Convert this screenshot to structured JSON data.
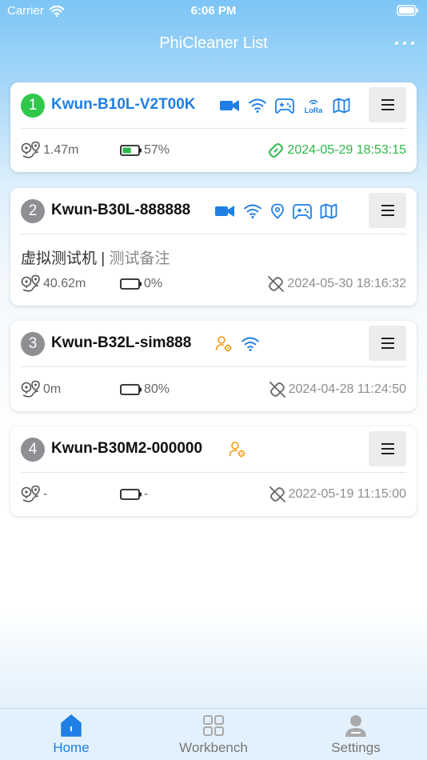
{
  "status_bar": {
    "carrier": "Carrier",
    "time": "6:06 PM"
  },
  "nav": {
    "title": "PhiCleaner List"
  },
  "colors": {
    "accent": "#1f7fe4",
    "online_green": "#2fb84a",
    "offline_gray": "#8e8e93",
    "warning_orange": "#f39c12"
  },
  "devices": [
    {
      "index": "1",
      "name": "Kwun-B10L-V2T00K",
      "online": true,
      "icons": [
        "video-icon",
        "wifi-icon",
        "gamepad-icon",
        "lora-icon",
        "map-icon"
      ],
      "distance": "1.47m",
      "battery": "57%",
      "battery_level": 0.57,
      "timestamp": "2024-05-29 18:53:15"
    },
    {
      "index": "2",
      "name": "Kwun-B30L-888888",
      "online": false,
      "icons": [
        "video-icon",
        "wifi-icon",
        "location-pin-icon",
        "gamepad-icon",
        "map-icon"
      ],
      "remark_name": "虚拟测试机",
      "remark_sep": "|",
      "remark_note": "测试备注",
      "distance": "40.62m",
      "battery": "0%",
      "battery_level": 0,
      "timestamp": "2024-05-30 18:16:32"
    },
    {
      "index": "3",
      "name": "Kwun-B32L-sim888",
      "online": false,
      "icons": [
        "user-settings-icon",
        "wifi-icon"
      ],
      "distance": "0m",
      "battery": "80%",
      "battery_level": 0.8,
      "timestamp": "2024-04-28 11:24:50"
    },
    {
      "index": "4",
      "name": "Kwun-B30M2-000000",
      "online": false,
      "icons": [
        "user-settings-icon"
      ],
      "distance": "-",
      "battery": "-",
      "battery_level": 0,
      "timestamp": "2022-05-19 11:15:00"
    }
  ],
  "tabs": [
    {
      "label": "Home",
      "icon": "home-icon",
      "active": true
    },
    {
      "label": "Workbench",
      "icon": "grid-icon",
      "active": false
    },
    {
      "label": "Settings",
      "icon": "person-icon",
      "active": false
    }
  ]
}
